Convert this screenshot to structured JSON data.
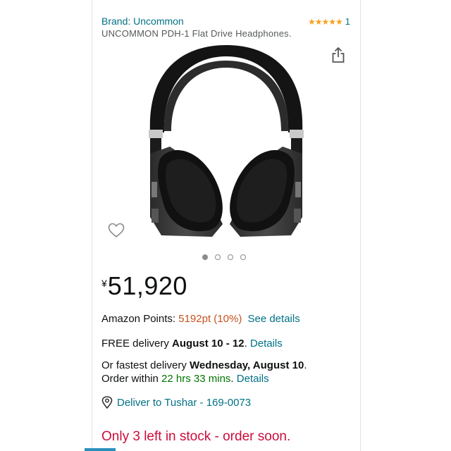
{
  "brand": "Brand: Uncommon",
  "rating": {
    "stars": "★★★★★",
    "count": "1",
    "value": 5,
    "max": 5
  },
  "product_title": "UNCOMMON PDH-1 Flat Drive Headphones.",
  "carousel": {
    "count": 4,
    "active": 1
  },
  "price": {
    "symbol": "¥",
    "value": "51,920"
  },
  "points": {
    "label": "Amazon Points:",
    "amount": "5192pt",
    "percent": "(10%)",
    "link": "See details"
  },
  "delivery": {
    "free_label": "FREE delivery",
    "date": "August 10 - 12",
    "sep": ".",
    "link": "Details"
  },
  "fastest": {
    "prefix": "Or fastest delivery",
    "date": "Wednesday, August 10",
    "period": ".",
    "order_prefix": "Order within",
    "time": "22 hrs 33 mins",
    "sep": ".",
    "link": "Details"
  },
  "deliver_to": "Deliver to Tushar - 169-0073",
  "stock": "Only 3 left in stock - order soon.",
  "colors": {
    "link": "#007185",
    "price_red": "#c7511f",
    "stock_red": "#cc0c39",
    "star": "#f7a11d",
    "green": "#007600"
  },
  "icons": {
    "share": "share-icon",
    "wishlist": "heart-icon",
    "location": "location-pin-icon"
  }
}
